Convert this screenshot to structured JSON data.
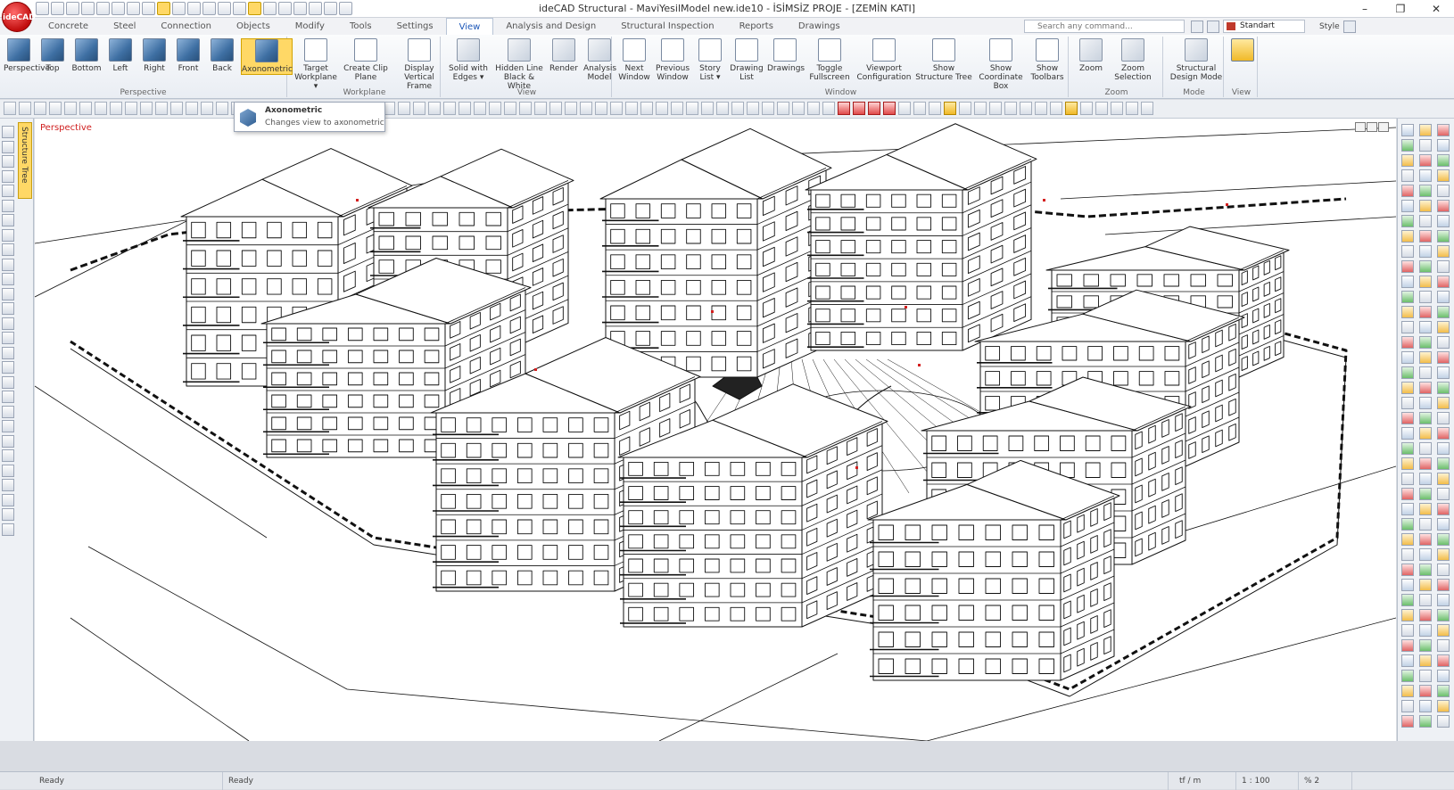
{
  "window_title": "ideCAD Structural - MaviYesilModel new.ide10 - İSİMSİZ PROJE - [ZEMİN KATI]",
  "app_logo": "ideCAD",
  "window_controls": [
    "–",
    "❐",
    "✕"
  ],
  "menu_tabs": [
    "Concrete",
    "Steel",
    "Connection",
    "Objects",
    "Modify",
    "Tools",
    "Settings",
    "View",
    "Analysis and Design",
    "Structural Inspection",
    "Reports",
    "Drawings"
  ],
  "active_tab": "View",
  "command_search_placeholder": "Search any command...",
  "style_selector": "Standart",
  "style_label": "Style",
  "ribbon": {
    "groups": [
      {
        "label": "Perspective",
        "buttons": [
          "Perspective",
          "Top",
          "Bottom",
          "Left",
          "Right",
          "Front",
          "Back",
          "Axonometric"
        ]
      },
      {
        "label": "Workplane",
        "buttons": [
          "Target Workplane ▾",
          "Create Clip Plane",
          "Display Vertical Frame"
        ]
      },
      {
        "label": "View",
        "buttons": [
          "Solid with Edges ▾",
          "Hidden Line Black & White",
          "Render",
          "Analysis Model"
        ]
      },
      {
        "label": "Window",
        "buttons": [
          "Next Window",
          "Previous Window",
          "Story List ▾",
          "Drawing List",
          "Drawings",
          "Toggle Fullscreen",
          "Viewport Configuration",
          "Show Structure Tree",
          "Show Coordinate Box",
          "Show Toolbars"
        ]
      },
      {
        "label": "Zoom",
        "buttons": [
          "Zoom",
          "Zoom Selection"
        ]
      },
      {
        "label": "Mode",
        "buttons": [
          "Structural Design Mode"
        ]
      },
      {
        "label": "View",
        "buttons": []
      }
    ]
  },
  "tooltip": {
    "title": "Axonometric",
    "description": "Changes view to axonometric"
  },
  "structure_tree_tab": "Structure Tree",
  "viewport_label": "Perspective",
  "status": {
    "left": "Ready",
    "second": "Ready",
    "units": "tf / m",
    "scale": "1 : 100",
    "zoom": "% 2"
  },
  "colors": {
    "accent": "#1c57b8",
    "active_button": "#ffd866",
    "viewport_label": "#d02020",
    "logo": "#c10d0d"
  }
}
